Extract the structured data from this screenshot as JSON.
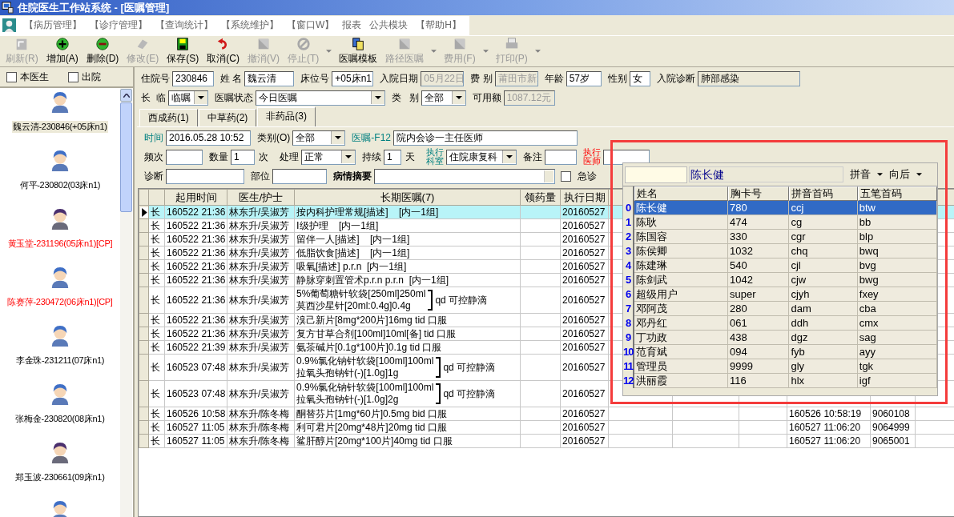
{
  "window": {
    "title": "住院医生工作站系统 - [医嘱管理]"
  },
  "menu": [
    "【病历管理】",
    "【诊疗管理】",
    "【查询统计】",
    "【系统维护】",
    "【窗口W】",
    "报表",
    "公共模块",
    "【帮助H】"
  ],
  "toolbar": [
    {
      "label": "刷新(R)",
      "disabled": true,
      "dropdown": false
    },
    {
      "label": "增加(A)",
      "disabled": false,
      "dropdown": false
    },
    {
      "label": "删除(D)",
      "disabled": false,
      "dropdown": false
    },
    {
      "label": "修改(E)",
      "disabled": true,
      "dropdown": false
    },
    {
      "label": "保存(S)",
      "disabled": false,
      "dropdown": false
    },
    {
      "label": "取消(C)",
      "disabled": false,
      "dropdown": false
    },
    {
      "label": "撤消(V)",
      "disabled": true,
      "dropdown": false
    },
    {
      "label": "停止(T)",
      "disabled": true,
      "dropdown": true
    },
    {
      "label": "医嘱模板",
      "disabled": false,
      "dropdown": false
    },
    {
      "label": "路径医嘱",
      "disabled": true,
      "dropdown": true
    },
    {
      "label": "费用(F)",
      "disabled": true,
      "dropdown": true
    },
    {
      "label": "打印(P)",
      "disabled": true,
      "dropdown": true
    }
  ],
  "sidebar": {
    "filters": [
      {
        "label": "本医生",
        "checked": false
      },
      {
        "label": "出院",
        "checked": false
      }
    ],
    "patients": [
      {
        "label": "魏云清-230846(+05床n1)",
        "kind": "female",
        "flagged": false,
        "selected": true
      },
      {
        "label": "何平-230802(03床n1)",
        "kind": "female",
        "flagged": false,
        "selected": false
      },
      {
        "label": "黄玉堂-231196(05床n1)[CP]",
        "kind": "male",
        "flagged": true,
        "selected": false
      },
      {
        "label": "陈赛萍-230472(06床n1)[CP]",
        "kind": "female",
        "flagged": true,
        "selected": false
      },
      {
        "label": "李金珠-231211(07床n1)",
        "kind": "female",
        "flagged": false,
        "selected": false
      },
      {
        "label": "张梅金-230820(08床n1)",
        "kind": "female",
        "flagged": false,
        "selected": false
      },
      {
        "label": "郑玉波-230661(09床n1)",
        "kind": "male",
        "flagged": false,
        "selected": false
      }
    ]
  },
  "patient_info": [
    {
      "label": "住院号",
      "value": "230846",
      "disabled": false
    },
    {
      "label": "姓 名",
      "value": "魏云清",
      "disabled": false
    },
    {
      "label": "床位号",
      "value": "+05床n1",
      "disabled": false
    },
    {
      "label": "入院日期",
      "value": "05月22日",
      "disabled": true
    },
    {
      "label": "费 别",
      "value": "莆田市新:",
      "disabled": true
    },
    {
      "label": "年龄",
      "value": "57岁",
      "disabled": false
    },
    {
      "label": "性别",
      "value": "女",
      "disabled": false
    },
    {
      "label": "入院诊断",
      "value": "肺部感染",
      "disabled": false
    }
  ],
  "order_filter": [
    {
      "label": "长  临",
      "value": "临嘱",
      "kind": "select",
      "disabled": false
    },
    {
      "label": "医嘱状态",
      "value": "今日医嘱",
      "kind": "select",
      "disabled": false
    },
    {
      "label": "类   别",
      "value": "全部",
      "kind": "select",
      "disabled": false
    },
    {
      "label": "可用额",
      "value": "1087.12元",
      "kind": "text",
      "disabled": true
    }
  ],
  "tabs": [
    {
      "label": "西成药(1)",
      "selected": false
    },
    {
      "label": "中草药(2)",
      "selected": false
    },
    {
      "label": "非药品(3)",
      "selected": true
    }
  ],
  "order_form": [
    [
      {
        "label": "时间",
        "kind": "text",
        "value": "2016.05.28 10:52"
      },
      {
        "label": "类别(O)",
        "kind": "select",
        "value": "全部"
      },
      {
        "label": "医嘱-F12",
        "kind": "text",
        "value": "院内会诊一主任医师"
      }
    ],
    [
      {
        "label": "频次",
        "kind": "text"
      },
      {
        "label": "数量",
        "kind": "text",
        "value": "1",
        "unit": "次"
      },
      {
        "label": "处理",
        "kind": "select",
        "value": "正常"
      },
      {
        "label": "持续",
        "kind": "text",
        "value": "1",
        "unit": "天"
      },
      {
        "label": "执行科室",
        "kind": "select",
        "value": "住院康复科"
      },
      {
        "label": "备注",
        "kind": "text"
      },
      {
        "label": "执行医师",
        "kind": "text"
      }
    ],
    [
      {
        "label": "诊断",
        "kind": "text"
      },
      {
        "label": "部位",
        "kind": "text"
      },
      {
        "label": "病情摘要",
        "kind": "memo"
      },
      {
        "label": "急诊",
        "kind": "checkbox",
        "checked": false
      }
    ]
  ],
  "table": {
    "columns": [
      "起用时间",
      "医生/护士",
      "长期医嘱(7)",
      "领药量",
      "执行日期"
    ],
    "rows": [
      {
        "selected": true,
        "type": "长",
        "start": "160522 21:36",
        "staff": "林东升/吴淑芳",
        "order": [
          "按内科护理常规[描述]    [内一1组]"
        ],
        "exec_date": "20160527"
      },
      {
        "selected": false,
        "type": "长",
        "start": "160522 21:36",
        "staff": "林东升/吴淑芳",
        "order": [
          "Ⅰ级护理    [内一1组]"
        ],
        "exec_date": "20160527"
      },
      {
        "selected": false,
        "type": "长",
        "start": "160522 21:36",
        "staff": "林东升/吴淑芳",
        "order": [
          "留伴一人[描述]    [内一1组]"
        ],
        "exec_date": "20160527"
      },
      {
        "selected": false,
        "type": "长",
        "start": "160522 21:36",
        "staff": "林东升/吴淑芳",
        "order": [
          "低脂饮食[描述]    [内一1组]"
        ],
        "exec_date": "20160527"
      },
      {
        "selected": false,
        "type": "长",
        "start": "160522 21:36",
        "staff": "林东升/吴淑芳",
        "order": [
          "吸氧[描述] p.r.n  [内一1组]"
        ],
        "exec_date": "20160527"
      },
      {
        "selected": false,
        "type": "长",
        "start": "160522 21:36",
        "staff": "林东升/吴淑芳",
        "order": [
          "静脉穿刺置管术p.r.n p.r.n  [内一1组]"
        ],
        "exec_date": "20160527"
      },
      {
        "selected": false,
        "type": "长",
        "start": "160522 21:36",
        "staff": "林东升/吴淑芳",
        "order": [
          "5%葡萄糖针软袋[250ml]250ml",
          "莫西沙星针[20ml:0.4g]0.4g"
        ],
        "route": "qd 可控静滴",
        "exec_date": "20160527"
      },
      {
        "selected": false,
        "type": "长",
        "start": "160522 21:36",
        "staff": "林东升/吴淑芳",
        "order": [
          "溴己新片[8mg*200片]16mg tid 口服"
        ],
        "exec_date": "20160527"
      },
      {
        "selected": false,
        "type": "长",
        "start": "160522 21:36",
        "staff": "林东升/吴淑芳",
        "order": [
          "复方甘草合剂[100ml]10ml[备] tid 口服"
        ],
        "exec_date": "20160527"
      },
      {
        "selected": false,
        "type": "长",
        "start": "160522 21:39",
        "staff": "林东升/吴淑芳",
        "order": [
          "氨茶碱片[0.1g*100片]0.1g tid 口服"
        ],
        "exec_date": "20160527"
      },
      {
        "selected": false,
        "type": "长",
        "start": "160523 07:48",
        "staff": "林东升/吴淑芳",
        "order": [
          "0.9%氯化钠针软袋[100ml]100ml",
          "拉氧头孢钠针(-)[1.0g]1g"
        ],
        "route": "qd 可控静滴",
        "exec_date": "20160527"
      },
      {
        "selected": false,
        "type": "长",
        "start": "160523 07:48",
        "staff": "林东升/吴淑芳",
        "order": [
          "0.9%氯化钠针软袋[100ml]100ml",
          "拉氧头孢钠针(-)[1.0g]2g"
        ],
        "route": "qd 可控静滴",
        "exec_date": "20160527"
      },
      {
        "selected": false,
        "type": "长",
        "start": "160526 10:58",
        "staff": "林东升/陈冬梅",
        "order": [
          "酮替芬片[1mg*60片]0.5mg bid 口服"
        ],
        "exec_date": "20160527",
        "column_9": "160526 10:58:19",
        "column_10": "9060108"
      },
      {
        "selected": false,
        "type": "长",
        "start": "160527 11:05",
        "staff": "林东升/陈冬梅",
        "order": [
          "利可君片[20mg*48片]20mg tid 口服"
        ],
        "exec_date": "20160527",
        "column_9": "160527 11:06:20",
        "column_10": "9064999"
      },
      {
        "selected": false,
        "type": "长",
        "start": "160527 11:05",
        "staff": "林东升/陈冬梅",
        "order": [
          "鲨肝醇片[20mg*100片]40mg tid 口服"
        ],
        "exec_date": "20160527",
        "column_9": "160527 11:06:20",
        "column_10": "9065001"
      }
    ]
  },
  "picker": {
    "name": "陈长健",
    "options": [
      "拼音",
      "向后"
    ],
    "columns": [
      "姓名",
      "胸卡号",
      "拼音首码",
      "五笔首码"
    ],
    "rows": [
      {
        "index": "0",
        "name": "陈长健",
        "card": "780",
        "pinyin": "ccj",
        "wubi": "btw",
        "selected": true
      },
      {
        "index": "1",
        "name": "陈耿",
        "card": "474",
        "pinyin": "cg",
        "wubi": "bb",
        "selected": false
      },
      {
        "index": "2",
        "name": "陈国容",
        "card": "330",
        "pinyin": "cgr",
        "wubi": "blp",
        "selected": false
      },
      {
        "index": "3",
        "name": "陈侯卿",
        "card": "1032",
        "pinyin": "chq",
        "wubi": "bwq",
        "selected": false
      },
      {
        "index": "4",
        "name": "陈建琳",
        "card": "540",
        "pinyin": "cjl",
        "wubi": "bvg",
        "selected": false
      },
      {
        "index": "5",
        "name": "陈剑武",
        "card": "1042",
        "pinyin": "cjw",
        "wubi": "bwg",
        "selected": false
      },
      {
        "index": "6",
        "name": "超级用户",
        "card": "super",
        "pinyin": "cjyh",
        "wubi": "fxey",
        "selected": false
      },
      {
        "index": "7",
        "name": "邓阿茂",
        "card": "280",
        "pinyin": "dam",
        "wubi": "cba",
        "selected": false
      },
      {
        "index": "8",
        "name": "邓丹红",
        "card": "061",
        "pinyin": "ddh",
        "wubi": "cmx",
        "selected": false
      },
      {
        "index": "9",
        "name": "丁功政",
        "card": "438",
        "pinyin": "dgz",
        "wubi": "sag",
        "selected": false
      },
      {
        "index": "10",
        "name": "范育斌",
        "card": "094",
        "pinyin": "fyb",
        "wubi": "ayy",
        "selected": false
      },
      {
        "index": "11",
        "name": "管理员",
        "card": "9999",
        "pinyin": "gly",
        "wubi": "tgk",
        "selected": false
      },
      {
        "index": "12",
        "name": "洪丽霞",
        "card": "116",
        "pinyin": "hlx",
        "wubi": "igf",
        "selected": false
      }
    ]
  }
}
